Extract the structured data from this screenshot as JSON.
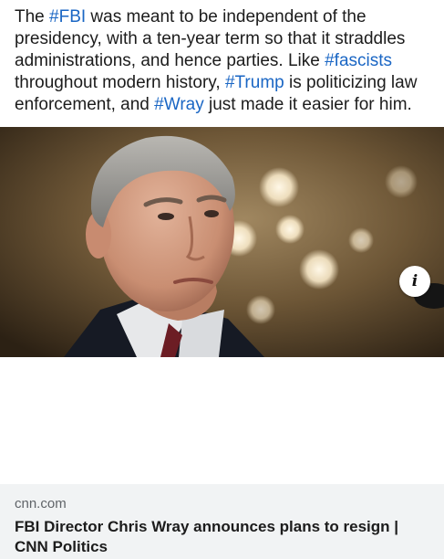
{
  "post": {
    "segments": [
      {
        "text": "The ",
        "tag": false
      },
      {
        "text": "#FBI",
        "tag": true
      },
      {
        "text": " was meant to be independent of the presidency, with a ten-year term so that it straddles administrations, and hence parties. Like ",
        "tag": false
      },
      {
        "text": "#fascists",
        "tag": true
      },
      {
        "text": " throughout modern history, ",
        "tag": false
      },
      {
        "text": "#Trump",
        "tag": true
      },
      {
        "text": " is politicizing law enforcement, and ",
        "tag": false
      },
      {
        "text": "#Wray",
        "tag": true
      },
      {
        "text": " just made it easier for him.",
        "tag": false
      }
    ]
  },
  "link_card": {
    "info_icon": "info-icon",
    "domain": "cnn.com",
    "title": "FBI Director Chris Wray announces plans to resign | CNN Politics"
  },
  "colors": {
    "hashtag": "#1a66c4",
    "footer_background": "#f1f3f4",
    "domain_text": "#5f6368"
  }
}
